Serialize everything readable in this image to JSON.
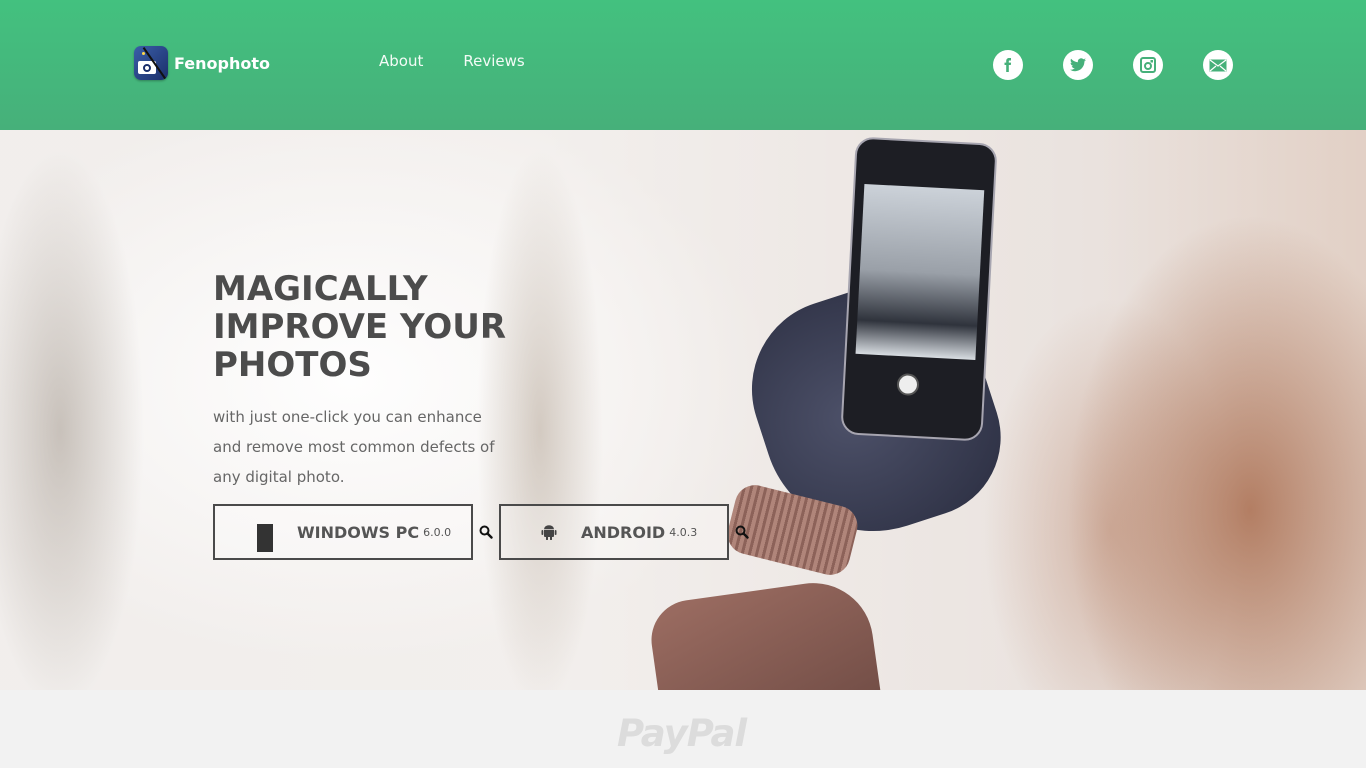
{
  "header": {
    "brand": "Fenophoto",
    "nav": [
      {
        "label": "About"
      },
      {
        "label": "Reviews"
      }
    ],
    "social": [
      {
        "icon": "facebook-icon",
        "glyph": "f"
      },
      {
        "icon": "twitter-icon",
        "glyph": "t"
      },
      {
        "icon": "instagram-icon",
        "glyph": "◙"
      },
      {
        "icon": "email-icon",
        "glyph": "✉"
      }
    ],
    "accent": "#43c17f"
  },
  "hero": {
    "title": "MAGICALLY IMPROVE YOUR PHOTOS",
    "subtitle": "with just one-click you can enhance and remove most common defects of any digital photo.",
    "downloads": [
      {
        "label": "WINDOWS PC",
        "version": "6.0.0",
        "icon": "windows-icon"
      },
      {
        "label": "ANDROID",
        "version": "4.0.3",
        "icon": "android-icon"
      }
    ]
  },
  "footer": {
    "partner_logo": "PayPal"
  }
}
